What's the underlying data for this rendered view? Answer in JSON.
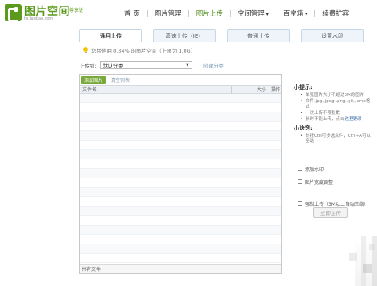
{
  "header": {
    "logo_title": "图片空间",
    "logo_badge": "尊享版",
    "logo_sub": "tu.taobao.com"
  },
  "nav": {
    "items": [
      {
        "label": "首 页",
        "has_arrow": false
      },
      {
        "label": "图片管理",
        "has_arrow": false
      },
      {
        "label": "图片上传",
        "has_arrow": false,
        "active": true
      },
      {
        "label": "空间管理",
        "has_arrow": true
      },
      {
        "label": "百宝箱",
        "has_arrow": true
      },
      {
        "label": "续费扩容",
        "has_arrow": false
      }
    ],
    "arrow": "▾"
  },
  "tabs": [
    "通用上传",
    "高速上传（IE）",
    "普通上传",
    "设置水印"
  ],
  "quota": {
    "text": "您共使用 0.34% 的图片空间（上限为 1.0G）"
  },
  "category": {
    "label": "上传到:",
    "selected": "默认分类",
    "caret": "▼",
    "create_link": "创建分类"
  },
  "file_panel": {
    "add_button": "添加图片",
    "clear_link": "清空列表",
    "columns": {
      "name": "文件名",
      "size": "大小",
      "op": "操作"
    },
    "footer": "共有文件"
  },
  "tips": {
    "title1": "小提示:",
    "items1": [
      "单张图片大小不超过3M的图片",
      "文件.jpg,.jpeg,.png,.gif,.bmp格式",
      "一次上传不限张数",
      "长时不能上传，点击这里更改"
    ],
    "link_text": "这里更改",
    "title2": "小诀窍:",
    "items2": [
      "长按Ctrl可多选文件，Ctrl+A可以全选"
    ]
  },
  "options": {
    "opt1": "添加水印",
    "opt2": "图片宽度调整",
    "opt3": "强制上传（3M以上自动压缩）"
  },
  "upload_button": "立即上传"
}
